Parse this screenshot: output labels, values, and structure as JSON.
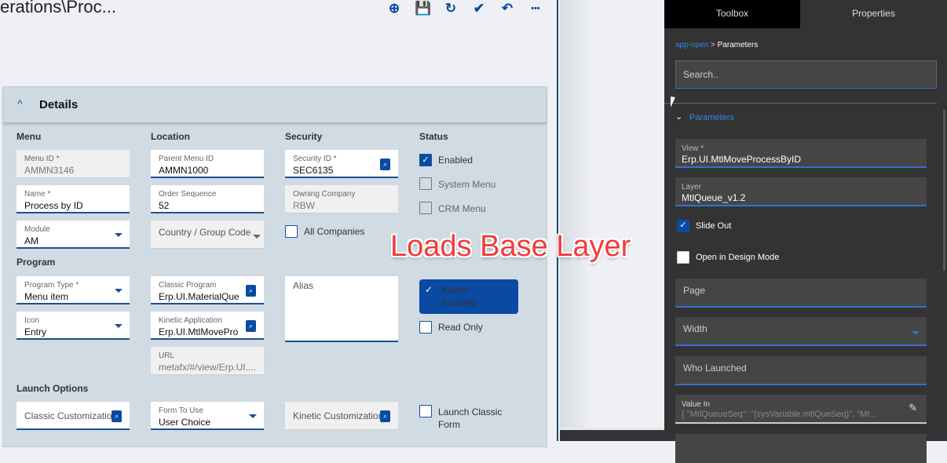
{
  "header": {
    "title": "erations\\Proc...",
    "toolbar": [
      {
        "name": "add",
        "glyph": "⊕"
      },
      {
        "name": "save",
        "glyph": "■"
      },
      {
        "name": "refresh",
        "glyph": "↻"
      },
      {
        "name": "clear",
        "glyph": "✔"
      },
      {
        "name": "undo",
        "glyph": "↶"
      },
      {
        "name": "more",
        "glyph": "•••"
      }
    ]
  },
  "details": {
    "title": "Details",
    "sections": {
      "menu": "Menu",
      "location": "Location",
      "security": "Security",
      "status": "Status",
      "program": "Program",
      "launch": "Launch Options"
    },
    "fields": {
      "menu_id": {
        "label": "Menu ID *",
        "value": "AMMN3146"
      },
      "name": {
        "label": "Name *",
        "value": "Process by ID"
      },
      "module": {
        "label": "Module",
        "value": "AM"
      },
      "parent_menu_id": {
        "label": "Parent Menu ID",
        "value": "AMMN1000"
      },
      "order_sequence": {
        "label": "Order Sequence",
        "value": "52"
      },
      "country_group_code": {
        "placeholder": "Country / Group Code"
      },
      "security_id": {
        "label": "Security ID *",
        "value": "SEC6135"
      },
      "owning_company": {
        "label": "Owning Company",
        "value": "RBW"
      },
      "program_type": {
        "label": "Program Type *",
        "value": "Menu item"
      },
      "icon": {
        "label": "Icon",
        "value": "Entry"
      },
      "classic_program": {
        "label": "Classic Program",
        "value": "Erp.UI.MaterialQue"
      },
      "kinetic_application": {
        "label": "Kinetic Application",
        "value": "Erp.UI.MtlMovePro"
      },
      "url": {
        "label": "URL",
        "value": "metafx/#/view/Erp.UI...."
      },
      "alias": {
        "placeholder": "Alias"
      },
      "classic_customization": {
        "placeholder": "Classic Customization"
      },
      "form_to_use": {
        "label": "Form To Use",
        "value": "User Choice"
      },
      "kinetic_customization": {
        "placeholder": "Kinetic Customization"
      }
    },
    "checkboxes": {
      "all_companies": {
        "label": "All Companies",
        "checked": false
      },
      "enabled": {
        "label": "Enabled",
        "checked": true
      },
      "system_menu": {
        "label": "System Menu",
        "checked": false
      },
      "crm_menu": {
        "label": "CRM Menu",
        "checked": false
      },
      "kinetic_enabled": {
        "label1": "Kinetic",
        "label2": "Enabled",
        "checked": true
      },
      "read_only": {
        "label": "Read Only",
        "checked": false
      },
      "launch_classic": {
        "label1": "Launch Classic",
        "label2": "Form",
        "checked": false
      }
    }
  },
  "annotation": "Loads Base Layer",
  "panel": {
    "tabs": [
      "Toolbox",
      "Properties"
    ],
    "breadcrumb": {
      "parent": "app-open",
      "sep": ">",
      "current": "Parameters"
    },
    "search_placeholder": "Search..",
    "group": "Parameters",
    "view": {
      "label": "View *",
      "value": "Erp.UI.MtlMoveProcessByID"
    },
    "layer": {
      "label": "Layer",
      "value": "MtlQueue_v1.2"
    },
    "slide_out": "Slide Out",
    "design_mode": "Open in Design Mode",
    "page": "Page",
    "width": "Width",
    "who_launched": "Who Launched",
    "value_in": {
      "label": "Value In",
      "value": "{  \"MtlQueueSeq\": \"{sysVariable.mtlQueSeq}\", \"Mt..."
    }
  }
}
